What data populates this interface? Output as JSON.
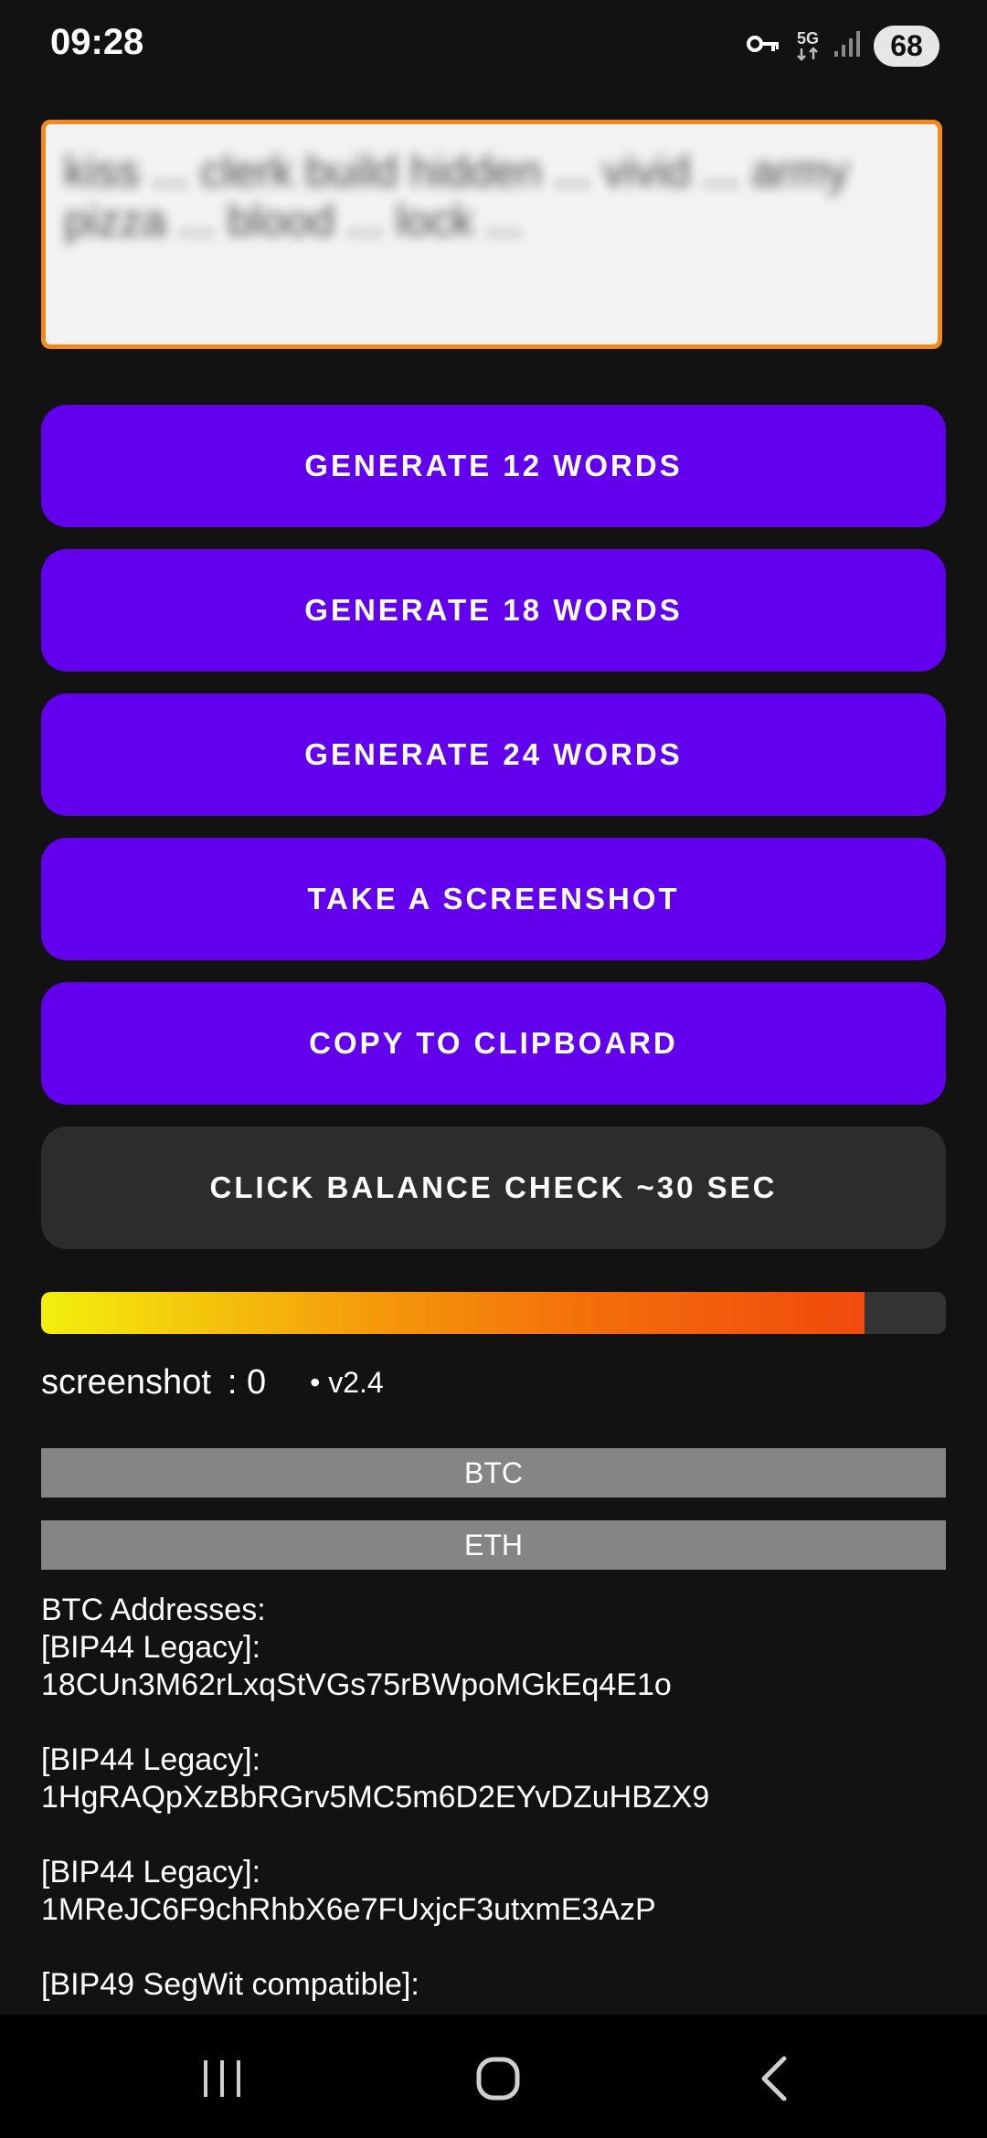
{
  "status_bar": {
    "time": "09:28",
    "network_label": "5G",
    "battery": "68",
    "icons": [
      "vpn-key-icon",
      "network-5g-icon",
      "signal-icon",
      "battery-icon"
    ]
  },
  "seed": {
    "text": "kiss ... clerk build hidden ... vivid ... army pizza ... blood ... lock ...",
    "state": "blurred",
    "border_color": "#f18a1c"
  },
  "buttons": {
    "gen12": "GENERATE 12 WORDS",
    "gen18": "GENERATE 18 WORDS",
    "gen24": "GENERATE 24 WORDS",
    "screenshot": "TAKE A SCREENSHOT",
    "copy": "COPY TO CLIPBOARD",
    "balance": "CLICK BALANCE CHECK ~30 SEC"
  },
  "colors": {
    "primary": "#6200ee",
    "secondary": "#2c2c2c",
    "tab": "#858585",
    "background": "#121212"
  },
  "progress": {
    "fraction": 0.91
  },
  "info": {
    "screenshot_label": "screenshot",
    "screenshot_count": ": 0",
    "version": "• v2.4"
  },
  "tabs": {
    "btc": "BTC",
    "eth": "ETH"
  },
  "addresses": {
    "title": "BTC Addresses:",
    "items": [
      {
        "type": "[BIP44 Legacy]:",
        "address": "18CUn3M62rLxqStVGs75rBWpoMGkEq4E1o"
      },
      {
        "type": "[BIP44 Legacy]:",
        "address": "1HgRAQpXzBbRGrv5MC5m6D2EYvDZuHBZX9"
      },
      {
        "type": "[BIP44 Legacy]:",
        "address": "1MReJC6F9chRhbX6e7FUxjcF3utxmE3AzP"
      },
      {
        "type": "[BIP49 SegWit compatible]:",
        "address": ""
      }
    ]
  },
  "nav": {
    "icons": [
      "recent-apps-icon",
      "home-icon",
      "back-icon"
    ]
  }
}
